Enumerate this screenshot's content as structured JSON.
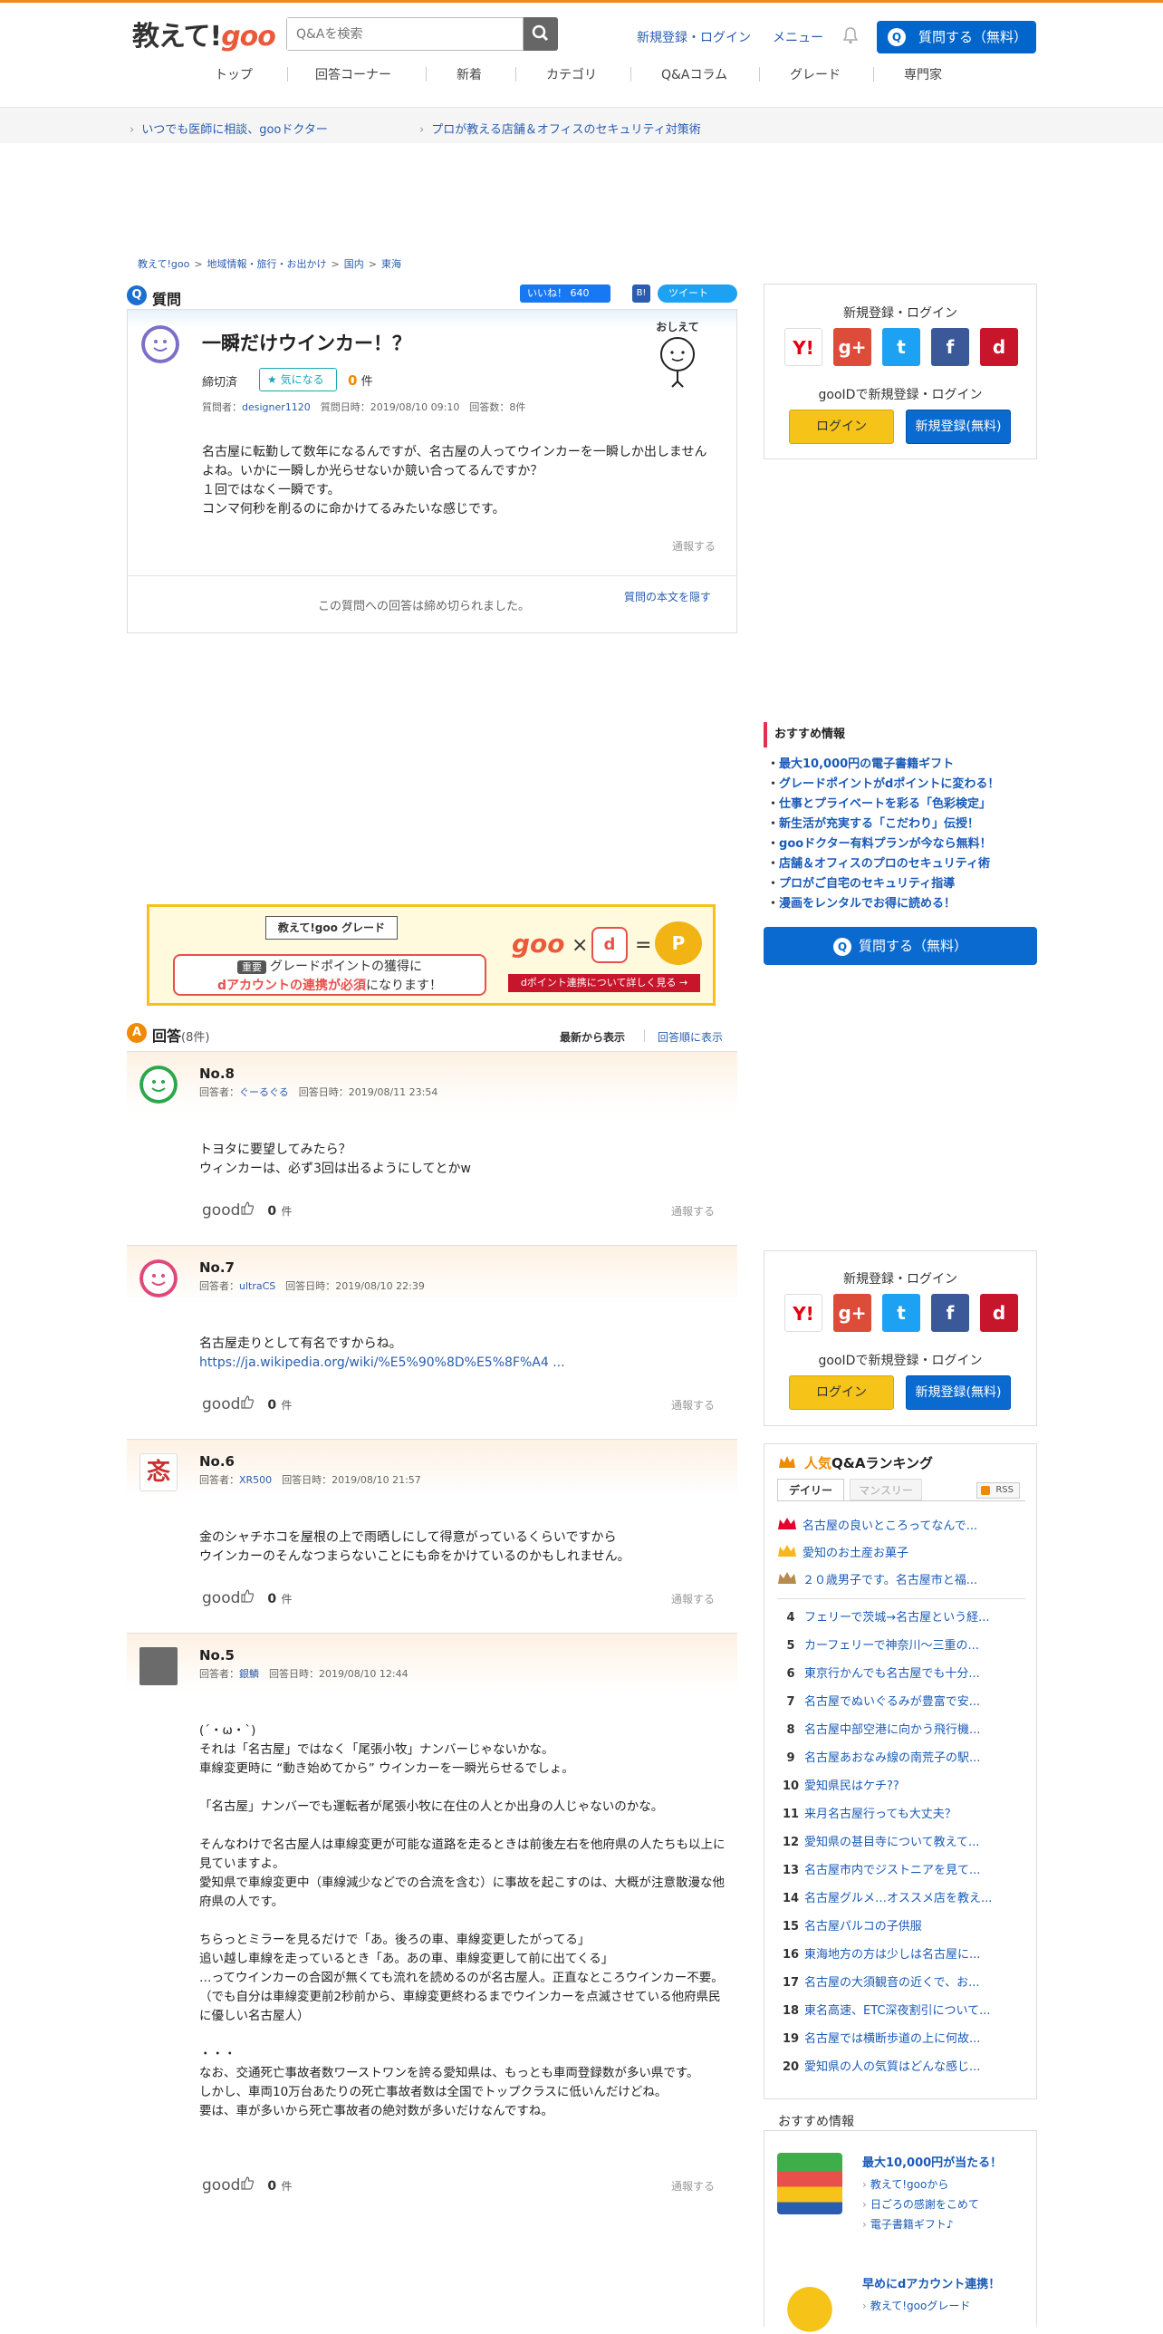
{
  "header": {
    "logo_text": "教えて!",
    "logo_goo": "goo",
    "search_placeholder": "Q&Aを検索",
    "links": [
      "新規登録・ログイン",
      "メニュー"
    ],
    "ask_button": "質問する（無料）"
  },
  "nav": [
    "トップ",
    "回答コーナー",
    "新着",
    "カテゴリ",
    "Q&Aコラム",
    "グレード",
    "専門家"
  ],
  "promo": [
    "いつでも医師に相談、gooドクター",
    "プロが教える店舗＆オフィスのセキュリティ対策術"
  ],
  "breadcrumb": [
    "教えて!goo",
    "地域情報・旅行・お出かけ",
    "国内",
    "東海"
  ],
  "question": {
    "section_label": "質問",
    "like_label": "いいね！ 640",
    "tweet_label": "ツイート",
    "title": "一瞬だけウインカー！？",
    "status": "締切済",
    "fav_label": "気になる",
    "fav_count": "0",
    "fav_unit": "件",
    "meta_asker_label": "質問者：",
    "asker": "designer1120",
    "meta_rest": "質問日時：2019/08/10 09:10　回答数：8件",
    "body": "名古屋に転勤して数年になるんですが、名古屋の人ってウインカーを一瞬しか出しませんよね。いかに一瞬しか光らせないか競い合ってるんですか？\n１回ではなく一瞬です。\nコンマ何秒を削るのに命かけてるみたいな感じです。",
    "report": "通報する",
    "closed_text": "この質問への回答は締め切られました。",
    "hide_text": "質問の本文を隠す",
    "mascot_text": "おしえて"
  },
  "sidebar_login": {
    "title": "新規登録・ログイン",
    "gooid_text": "gooIDで新規登録・ログイン",
    "login": "ログイン",
    "register": "新規登録(無料)",
    "social": [
      "Y!",
      "g+",
      "t",
      "f",
      "d"
    ]
  },
  "recommend": {
    "title": "おすすめ情報",
    "items": [
      "最大10,000円の電子書籍ギフト",
      "グレードポイントがdポイントに変わる！",
      "仕事とプライベートを彩る「色彩検定」",
      "新生活が充実する「こだわり」伝授！",
      "gooドクター有料プランが今なら無料！",
      "店舗＆オフィスのプロのセキュリティ術",
      "プロがご自宅のセキュリティ指導",
      "漫画をレンタルでお得に読める！"
    ],
    "ask_button": "質問する（無料）"
  },
  "banner": {
    "title": "教えて!goo グレード",
    "line1_badge": "重要",
    "line1": "グレードポイントの獲得に",
    "line2_bold": "dアカウントの連携が必須",
    "line2_rest": "になります！",
    "goo": "goo",
    "times": "×",
    "d": "d",
    "equals": "=",
    "coins": "P",
    "link": "dポイント連携について詳しく見る →"
  },
  "answers_header": {
    "label": "回答",
    "count": "(8件)",
    "sort_new": "最新から表示",
    "sort_old": "回答順に表示"
  },
  "answers": [
    {
      "no": "No.8",
      "author": "ぐーるぐる",
      "date": "回答日時：2019/08/11 23:54",
      "body": "トヨタに要望してみたら？\nウィンカーは、必ず3回は出るようにしてとかw",
      "count": "0",
      "unit": "件"
    },
    {
      "no": "No.7",
      "author": "ultraCS",
      "date": "回答日時：2019/08/10 22:39",
      "body": "名古屋走りとして有名ですからね。",
      "link": "https://ja.wikipedia.org/wiki/%E5%90%8D%E5%8F%A4 ...",
      "count": "0",
      "unit": "件"
    },
    {
      "no": "No.6",
      "author": "XR500",
      "date": "回答日時：2019/08/10 21:57",
      "body": "金のシャチホコを屋根の上で雨晒しにして得意がっているくらいですから\nウインカーのそんなつまらないことにも命をかけているのかもしれません。",
      "count": "0",
      "unit": "件"
    },
    {
      "no": "No.5",
      "author": "銀鱗",
      "date": "回答日時：2019/08/10 12:44",
      "body": "(´・ω・`)\nそれは「名古屋」ではなく「尾張小牧」ナンバーじゃないかな。\n車線変更時に “動き始めてから” ウインカーを一瞬光らせるでしょ。\n\n「名古屋」ナンバーでも運転者が尾張小牧に在住の人とか出身の人じゃないのかな。\n\nそんなわけで名古屋人は車線変更が可能な道路を走るときは前後左右を他府県の人たちも以上に見ていますよ。\n愛知県で車線変更中（車線減少などでの合流を含む）に事故を起こすのは、大概が注意散漫な他府県の人です。\n\nちらっとミラーを見るだけで「あ。後ろの車、車線変更したがってる」\n追い越し車線を走っているとき「あ。あの車、車線変更して前に出てくる」\n…ってウインカーの合図が無くても流れを読めるのが名古屋人。正直なところウインカー不要。\n（でも自分は車線変更前2秒前から、車線変更終わるまでウインカーを点滅させている他府県民に優しい名古屋人）\n\n・・・\nなお、交通死亡事故者数ワーストワンを誇る愛知県は、もっとも車両登録数が多い県です。\nしかし、車両10万台あたりの死亡事故者数は全国でトップクラスに低いんだけどね。\n要は、車が多いから死亡事故者の絶対数が多いだけなんですね。",
      "count": "0",
      "unit": "件"
    }
  ],
  "good_label": "good",
  "meta_answerer_label": "回答者：",
  "report": "通報する",
  "ranking": {
    "title_hot": "人気",
    "title_rest": "Q&Aランキング",
    "tab_daily": "デイリー",
    "tab_monthly": "マンスリー",
    "rss": "RSS",
    "items": [
      {
        "n": "1",
        "t": "名古屋の良いところってなんで..."
      },
      {
        "n": "2",
        "t": "愛知のお土産お菓子"
      },
      {
        "n": "3",
        "t": "２０歳男子です。名古屋市と福..."
      },
      {
        "n": "4",
        "t": "フェリーで茨城→名古屋という経..."
      },
      {
        "n": "5",
        "t": "カーフェリーで神奈川～三重の..."
      },
      {
        "n": "6",
        "t": "東京行かんでも名古屋でも十分..."
      },
      {
        "n": "7",
        "t": "名古屋でぬいぐるみが豊富で安..."
      },
      {
        "n": "8",
        "t": "名古屋中部空港に向かう飛行機..."
      },
      {
        "n": "9",
        "t": "名古屋あおなみ線の南荒子の駅..."
      },
      {
        "n": "10",
        "t": "愛知県民はケチ??"
      },
      {
        "n": "11",
        "t": "来月名古屋行っても大丈夫？"
      },
      {
        "n": "12",
        "t": "愛知県の甚目寺について教えて..."
      },
      {
        "n": "13",
        "t": "名古屋市内でジストニアを見て..."
      },
      {
        "n": "14",
        "t": "名古屋グルメ…オススメ店を教え..."
      },
      {
        "n": "15",
        "t": "名古屋パルコの子供服"
      },
      {
        "n": "16",
        "t": "東海地方の方は少しは名古屋に..."
      },
      {
        "n": "17",
        "t": "名古屋の大須観音の近くで、お..."
      },
      {
        "n": "18",
        "t": "東名高速、ETC深夜割引について..."
      },
      {
        "n": "19",
        "t": "名古屋では横断歩道の上に何故..."
      },
      {
        "n": "20",
        "t": "愛知県の人の気質はどんな感じ..."
      }
    ]
  },
  "recommend2": {
    "title": "おすすめ情報",
    "blocks": [
      {
        "title": "最大10,000円が当たる！",
        "subs": [
          "教えて!gooから",
          "日ごろの感謝をこめて",
          "電子書籍ギフト♪"
        ]
      },
      {
        "title": "早めにdアカウント連携！",
        "subs": [
          "教えて!gooグレード"
        ]
      }
    ]
  },
  "colors": {
    "accent": "#f28a18",
    "brand_blue": "#0b6ad0",
    "login_yellow": "#f6c318"
  }
}
